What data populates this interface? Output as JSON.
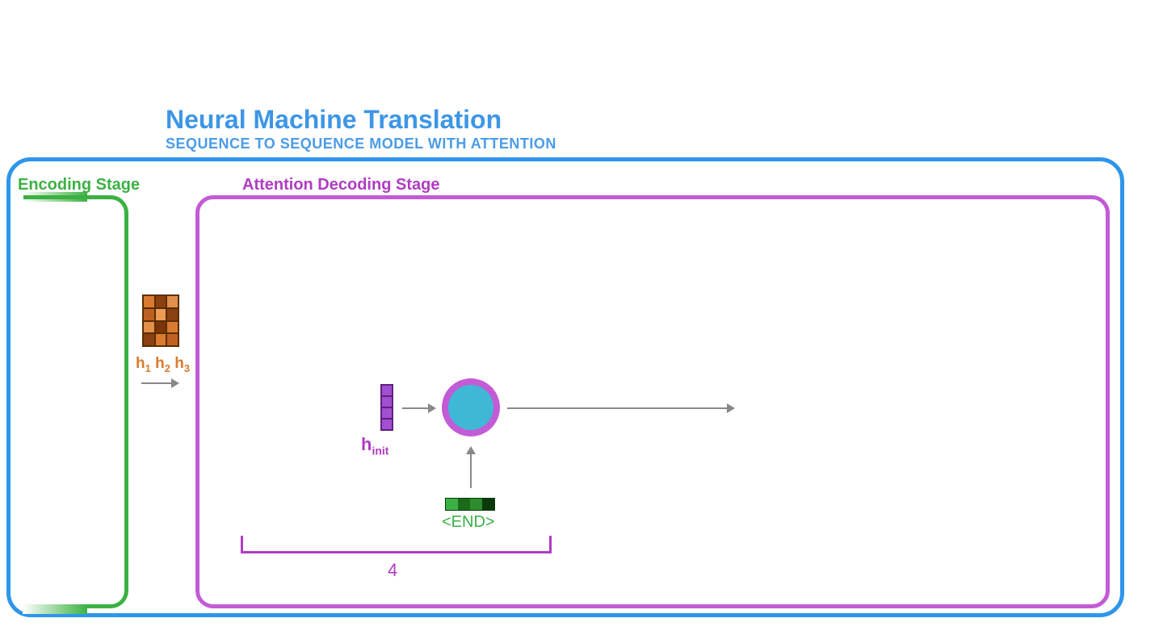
{
  "title": "Neural Machine Translation",
  "subtitle": "SEQUENCE TO SEQUENCE MODEL WITH ATTENTION",
  "encoding_stage_label": "Encoding Stage",
  "attention_stage_label": "Attention Decoding Stage",
  "hidden_states": {
    "h1": "h",
    "h1_sub": "1",
    "h2": "h",
    "h2_sub": "2",
    "h3": "h",
    "h3_sub": "3"
  },
  "hinit": {
    "label": "h",
    "sub": "init"
  },
  "end_token": "<END>",
  "step_number": "4",
  "colors": {
    "blue": "#2d96eb",
    "green": "#3bb143",
    "purple": "#b03cc2",
    "orange": "#d97a2e",
    "cyan": "#3fb8d6"
  }
}
